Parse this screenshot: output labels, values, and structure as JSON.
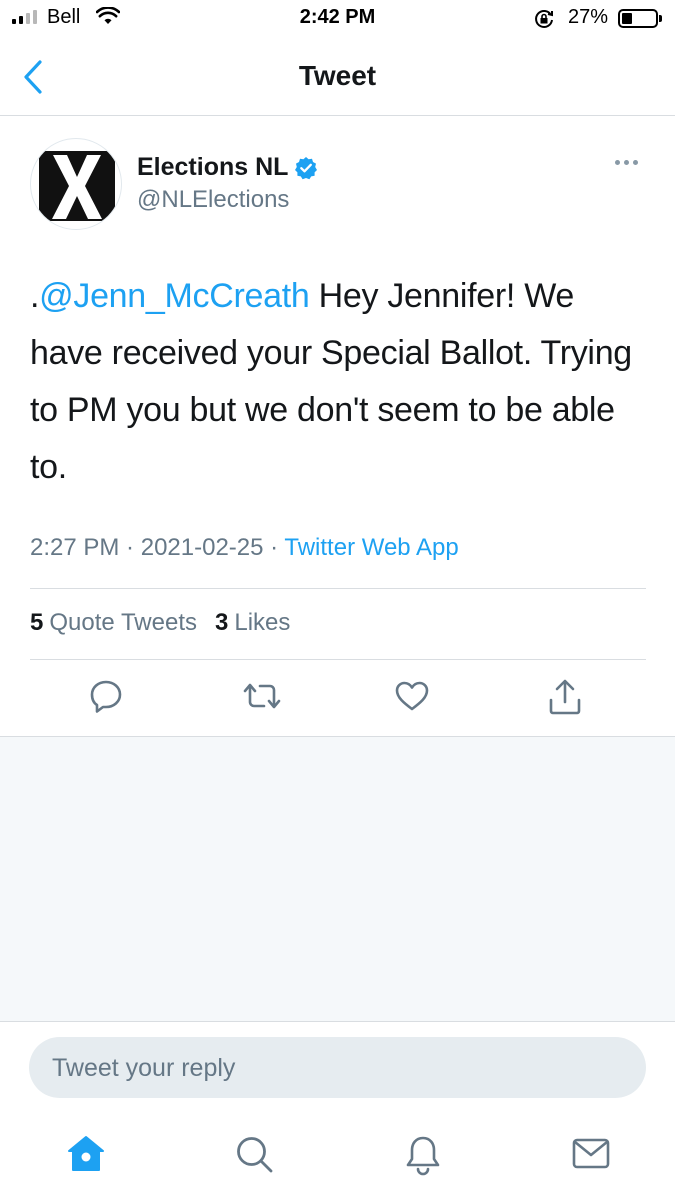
{
  "status_bar": {
    "carrier": "Bell",
    "time": "2:42 PM",
    "battery_percent": "27%",
    "battery_level": 0.27,
    "icons": [
      "signal-icon",
      "wifi-icon",
      "rotation-lock-icon",
      "battery-icon"
    ]
  },
  "nav": {
    "title": "Tweet",
    "back_icon": "chevron-left-icon"
  },
  "tweet": {
    "display_name": "Elections NL",
    "verified": true,
    "handle": "@NLElections",
    "text_prefix": ".",
    "mention": "@Jenn_McCreath",
    "text_body": " Hey Jennifer! We have received your Special Ballot. Trying to PM you but we don't seem to be able to.",
    "time": "2:27 PM",
    "separator": " · ",
    "date": "2021-02-25",
    "source": "Twitter Web App",
    "stats": {
      "quote_count": "5",
      "quote_label": "Quote Tweets",
      "like_count": "3",
      "like_label": "Likes"
    },
    "actions": [
      "reply-icon",
      "retweet-icon",
      "like-icon",
      "share-icon"
    ]
  },
  "reply": {
    "placeholder": "Tweet your reply"
  },
  "tabbar": {
    "items": [
      "home-icon",
      "search-icon",
      "notifications-icon",
      "messages-icon"
    ],
    "active": "home-icon"
  },
  "colors": {
    "accent": "#1da1f2",
    "text": "#14171a",
    "secondary": "#657786",
    "divider": "#d9dde1",
    "background_gray": "#f5f8fa"
  }
}
